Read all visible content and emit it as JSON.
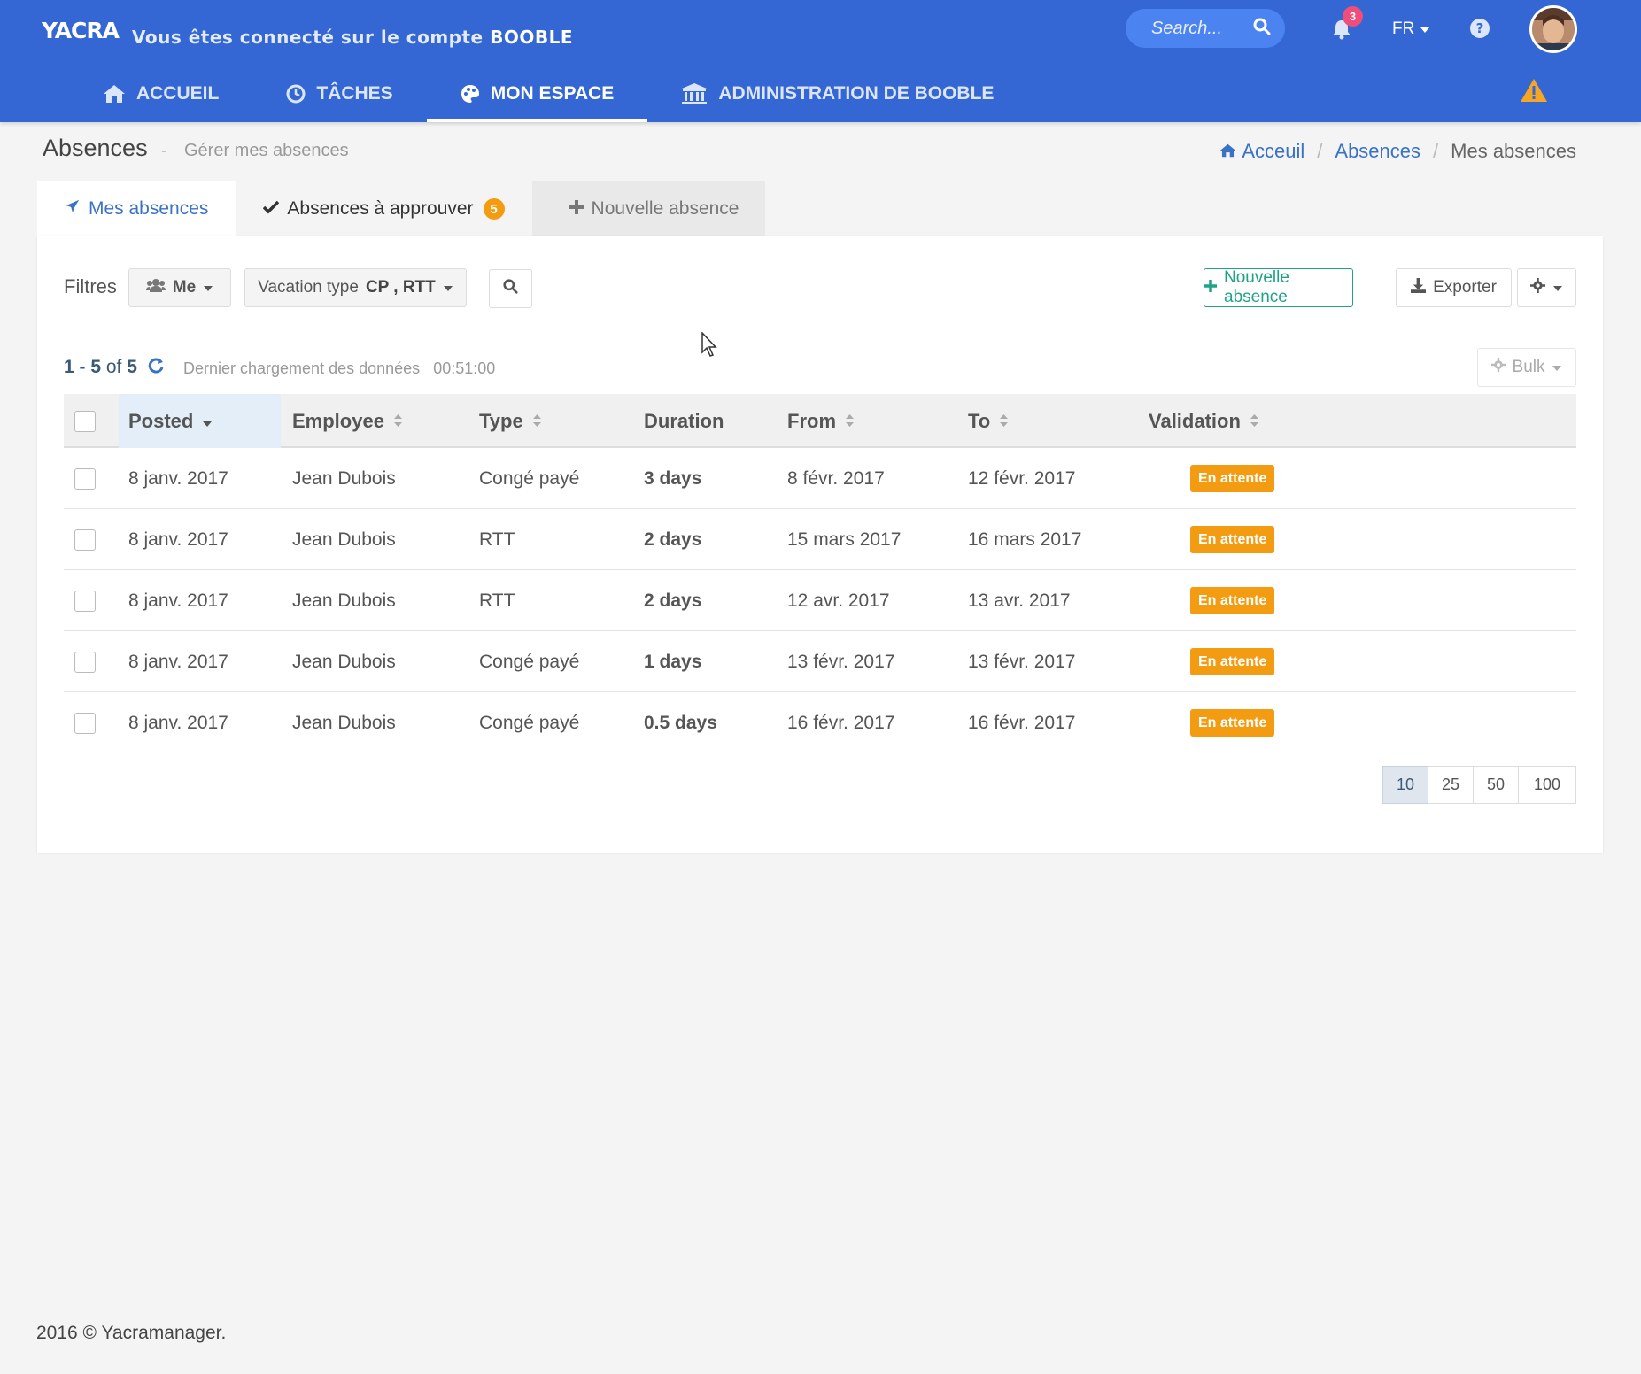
{
  "header": {
    "logo_text": "YACRA",
    "account_prefix": "Vous êtes connecté sur le compte",
    "account_name": "BOOBLE",
    "search_placeholder": "Search...",
    "notification_count": "3",
    "language": "FR",
    "nav": [
      {
        "label": "ACCUEIL",
        "icon": "home-icon"
      },
      {
        "label": "TÂCHES",
        "icon": "clock-icon"
      },
      {
        "label": "MON ESPACE",
        "icon": "palette-icon",
        "active": true
      },
      {
        "label": "ADMINISTRATION DE BOOBLE",
        "icon": "bank-icon"
      }
    ],
    "accent_color": "#3567d4"
  },
  "page": {
    "title": "Absences",
    "separator": "-",
    "subtitle": "Gérer mes absences",
    "breadcrumb": [
      "Acceuil",
      "Absences",
      "Mes absences"
    ]
  },
  "tabs": {
    "mine": "Mes absences",
    "approve": "Absences à approuver",
    "approve_count": "5",
    "new": "Nouvelle absence"
  },
  "toolbar": {
    "filters_label": "Filtres",
    "me_filter": "Me",
    "vacation_type_label": "Vacation type",
    "vacation_type_value": "CP , RTT",
    "new_absence": "Nouvelle absence",
    "export": "Exporter",
    "bulk": "Bulk"
  },
  "results": {
    "range": "1 - 5",
    "of": "of",
    "total": "5",
    "last_load_label": "Dernier chargement des données",
    "last_load_time": "00:51:00"
  },
  "table": {
    "columns": [
      "Posted",
      "Employee",
      "Type",
      "Duration",
      "From",
      "To",
      "Validation"
    ],
    "rows": [
      {
        "posted": "8 janv. 2017",
        "employee": "Jean Dubois",
        "type": "Congé payé",
        "duration": "3 days",
        "from": "8 févr. 2017",
        "to": "12 févr. 2017",
        "status": "En attente"
      },
      {
        "posted": "8 janv. 2017",
        "employee": "Jean Dubois",
        "type": "RTT",
        "duration": "2 days",
        "from": "15 mars 2017",
        "to": "16 mars 2017",
        "status": "En attente"
      },
      {
        "posted": "8 janv. 2017",
        "employee": "Jean Dubois",
        "type": "RTT",
        "duration": "2 days",
        "from": "12 avr. 2017",
        "to": "13 avr. 2017",
        "status": "En attente"
      },
      {
        "posted": "8 janv. 2017",
        "employee": "Jean Dubois",
        "type": "Congé payé",
        "duration": "1 days",
        "from": "13 févr. 2017",
        "to": "13 févr. 2017",
        "status": "En attente"
      },
      {
        "posted": "8 janv. 2017",
        "employee": "Jean Dubois",
        "type": "Congé payé",
        "duration": "0.5 days",
        "from": "16 févr. 2017",
        "to": "16 févr. 2017",
        "status": "En attente"
      }
    ],
    "status_color": "#f39c12"
  },
  "pagination": {
    "sizes": [
      "10",
      "25",
      "50",
      "100"
    ],
    "active": "10"
  },
  "footer": {
    "text": "2016 © Yacramanager."
  }
}
